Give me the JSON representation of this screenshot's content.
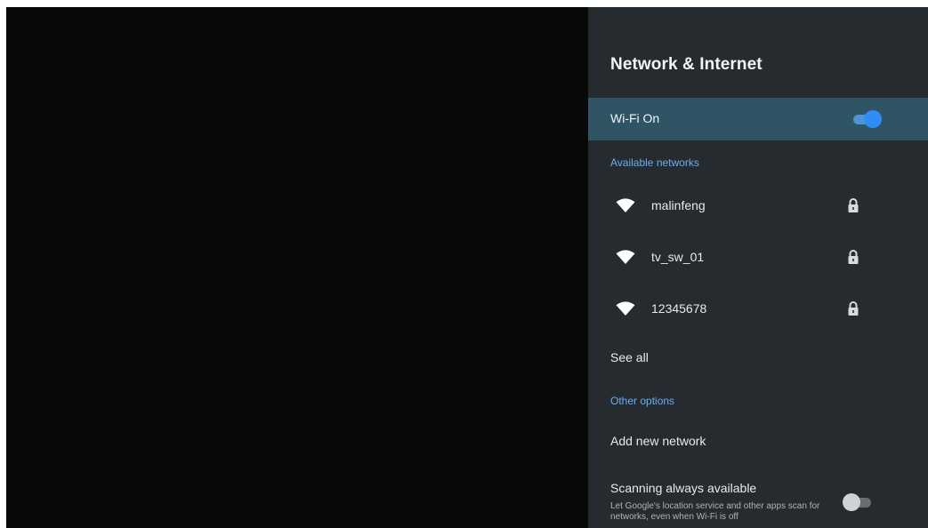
{
  "panel": {
    "title": "Network & Internet"
  },
  "wifi": {
    "label": "Wi-Fi On",
    "enabled": true
  },
  "available_networks": {
    "header": "Available networks",
    "items": [
      {
        "ssid": "malinfeng",
        "icon": "wifi-icon",
        "secured": true
      },
      {
        "ssid": "tv_sw_01",
        "icon": "wifi-icon",
        "secured": true
      },
      {
        "ssid": "12345678",
        "icon": "wifi-icon",
        "secured": true
      }
    ],
    "see_all": "See all"
  },
  "other_options": {
    "header": "Other options",
    "add_network": "Add new network",
    "scanning": {
      "title": "Scanning always available",
      "description": "Let Google's location service and other apps scan for networks, even when Wi-Fi is off",
      "enabled": false
    }
  },
  "colors": {
    "panel_background": "#262b30",
    "selected_row": "#2f5565",
    "accent": "#2f8ef5",
    "section_header": "#69aef2"
  }
}
